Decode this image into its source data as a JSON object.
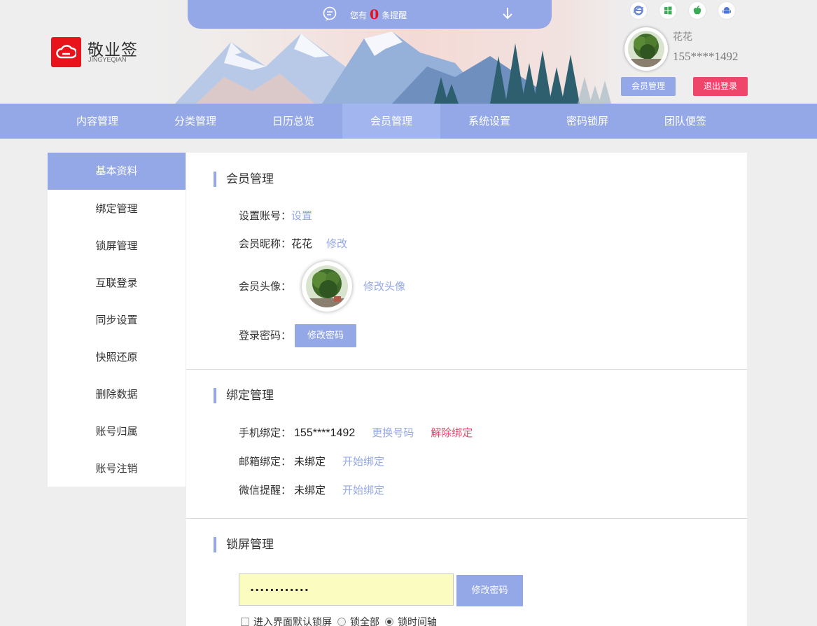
{
  "notice": {
    "prefix": "您有",
    "count": "0",
    "suffix": "条提醒"
  },
  "brand": {
    "name": "敬业签",
    "sub": "JINGYEQIAN"
  },
  "platforms": [
    "ie-icon",
    "windows-icon",
    "apple-icon",
    "android-icon"
  ],
  "user": {
    "name": "花花",
    "phone": "155****1492",
    "member_button": "会员管理",
    "logout_button": "退出登录"
  },
  "nav": {
    "items": [
      "内容管理",
      "分类管理",
      "日历总览",
      "会员管理",
      "系统设置",
      "密码锁屏",
      "团队便签"
    ],
    "active": "会员管理"
  },
  "sidebar": {
    "items": [
      "基本资料",
      "绑定管理",
      "锁屏管理",
      "互联登录",
      "同步设置",
      "快照还原",
      "删除数据",
      "账号归属",
      "账号注销"
    ],
    "active": "基本资料"
  },
  "member": {
    "title": "会员管理",
    "account_label": "设置账号：",
    "account_link": "设置",
    "nickname_label": "会员昵称：",
    "nickname_value": "花花",
    "nickname_link": "修改",
    "avatar_label": "会员头像：",
    "avatar_link": "修改头像",
    "password_label": "登录密码：",
    "password_button": "修改密码"
  },
  "binding": {
    "title": "绑定管理",
    "phone_label": "手机绑定：",
    "phone_value": "155****1492",
    "phone_change": "更换号码",
    "phone_unbind": "解除绑定",
    "email_label": "邮箱绑定：",
    "email_value": "未绑定",
    "email_link": "开始绑定",
    "wechat_label": "微信提醒：",
    "wechat_value": "未绑定",
    "wechat_link": "开始绑定"
  },
  "lock": {
    "title": "锁屏管理",
    "password_value": "············",
    "button": "修改密码",
    "checkbox_label": "进入界面默认锁屏",
    "radio1": "锁全部",
    "radio2": "锁时间轴",
    "selected": "锁时间轴"
  },
  "colors": {
    "accent": "#94a8e8",
    "danger": "#f0456b",
    "brand_red": "#e8131b"
  }
}
